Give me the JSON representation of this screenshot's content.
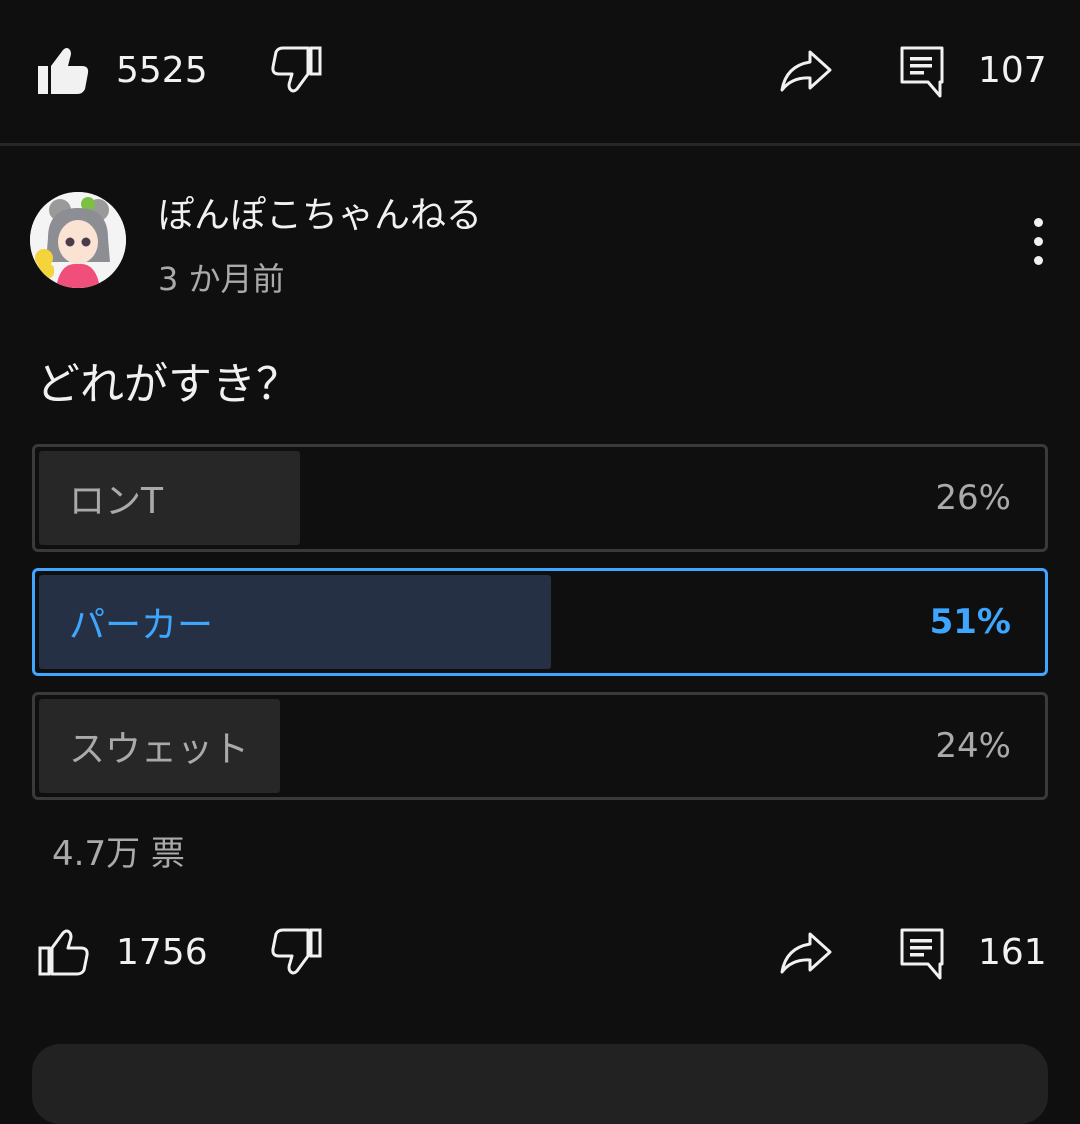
{
  "video_actions": {
    "like_count": "5525",
    "comment_count": "107",
    "icons": [
      "thumbs-up-filled-icon",
      "thumbs-down-icon",
      "share-icon",
      "comment-icon"
    ]
  },
  "post": {
    "author": "ぽんぽこちゃんねる",
    "time": "3 か月前",
    "text": "どれがすき？",
    "poll": {
      "options": [
        {
          "label": "ロンT",
          "percent_text": "26%",
          "percent": 26,
          "selected": false
        },
        {
          "label": "パーカー",
          "percent_text": "51%",
          "percent": 51,
          "selected": true
        },
        {
          "label": "スウェット",
          "percent_text": "24%",
          "percent": 24,
          "selected": false
        }
      ],
      "votes": "4.7万 票"
    },
    "actions": {
      "like_count": "1756",
      "comment_count": "161"
    }
  },
  "colors": {
    "background": "#0f0f0f",
    "accent": "#3ea6ff",
    "selected_fill": "#263044",
    "option_fill": "#272727",
    "secondary_text": "#aaaaaa"
  }
}
